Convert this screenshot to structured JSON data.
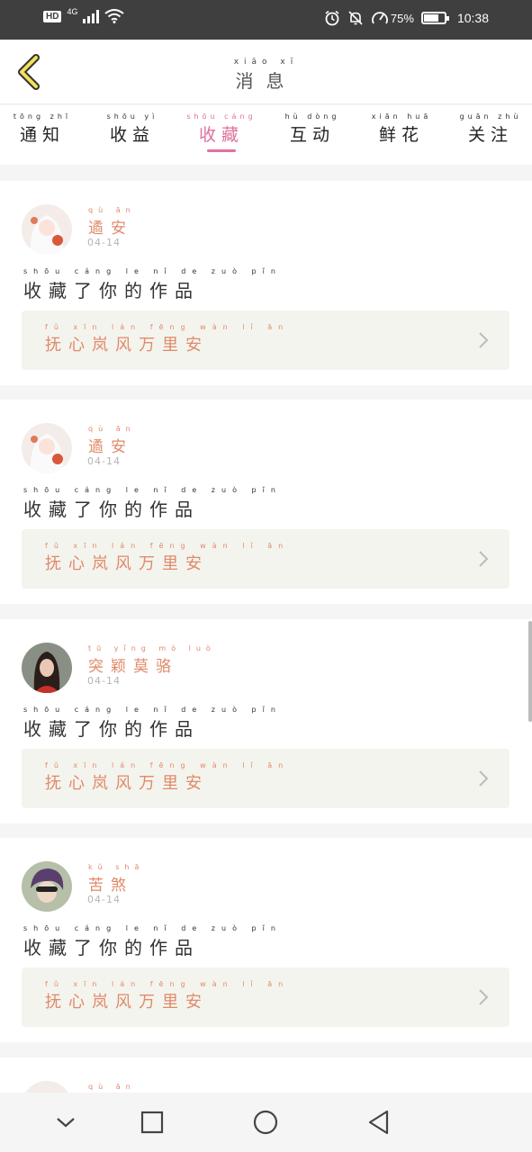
{
  "status_bar": {
    "hd": "HD",
    "network": "4G",
    "battery": "75%",
    "battery_level": 0.75,
    "time": "10:38"
  },
  "header": {
    "title_pinyin": "xiāo xī",
    "title": "消息"
  },
  "tabs": [
    {
      "pinyin": "tōng zhī",
      "label": "通知",
      "active": false
    },
    {
      "pinyin": "shōu yì",
      "label": "收益",
      "active": false
    },
    {
      "pinyin": "shōu cáng",
      "label": "收藏",
      "active": true
    },
    {
      "pinyin": "hù dòng",
      "label": "互动",
      "active": false
    },
    {
      "pinyin": "xiān huā",
      "label": "鲜花",
      "active": false
    },
    {
      "pinyin": "guān zhù",
      "label": "关注",
      "active": false
    }
  ],
  "messages": [
    {
      "user_pinyin": "qù ān",
      "user": "遹安",
      "date": "04-14",
      "action_pinyin": "shōu cáng le nǐ de zuò pǐn",
      "action": "收藏了你的作品",
      "work_pinyin": "fǔ xīn lán fēng wàn lǐ ān",
      "work": "抚心岚风万里安",
      "avatar": "anime"
    },
    {
      "user_pinyin": "qù ān",
      "user": "遹安",
      "date": "04-14",
      "action_pinyin": "shōu cáng le nǐ de zuò pǐn",
      "action": "收藏了你的作品",
      "work_pinyin": "fǔ xīn lán fēng wàn lǐ ān",
      "work": "抚心岚风万里安",
      "avatar": "anime"
    },
    {
      "user_pinyin": "tū yǐng mò luò",
      "user": "突颖莫骆",
      "date": "04-14",
      "action_pinyin": "shōu cáng le nǐ de zuò pǐn",
      "action": "收藏了你的作品",
      "work_pinyin": "fǔ xīn lán fēng wàn lǐ ān",
      "work": "抚心岚风万里安",
      "avatar": "girl"
    },
    {
      "user_pinyin": "kǔ shā",
      "user": "苦煞",
      "date": "04-14",
      "action_pinyin": "shōu cáng le nǐ de zuò pǐn",
      "action": "收藏了你的作品",
      "work_pinyin": "fǔ xīn lán fēng wàn lǐ ān",
      "work": "抚心岚风万里安",
      "avatar": "boy"
    }
  ],
  "partial_message": {
    "user_pinyin": "qù ān",
    "avatar": "anime"
  },
  "colors": {
    "accent": "#e0709f",
    "orange": "#e08a6a",
    "card_bg": "#f4f4ee"
  }
}
